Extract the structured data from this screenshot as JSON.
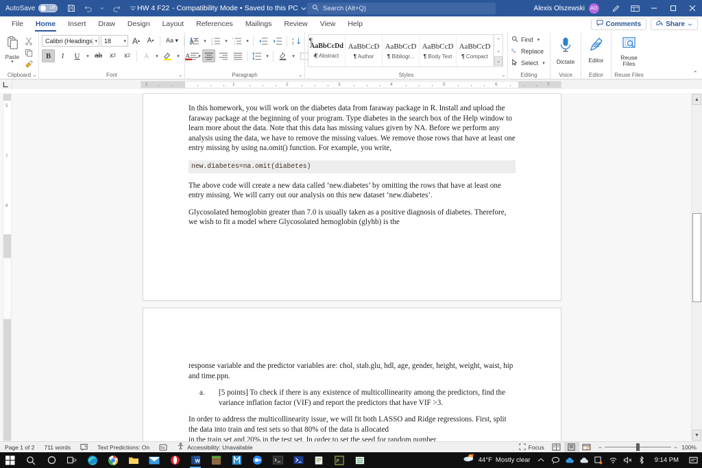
{
  "titlebar": {
    "autosave_label": "AutoSave",
    "autosave_state": "Off",
    "doc_title": "HW 4 F22",
    "doc_status": "-  Compatibility Mode  •  Saved to this PC",
    "search_placeholder": "Search (Alt+Q)",
    "user_name": "Alexis Olszewski",
    "user_initials": "AO",
    "icons": [
      "save-icon",
      "undo-icon",
      "redo-icon",
      "customize-quick-access-icon"
    ],
    "window_buttons": [
      "minimize",
      "restore",
      "close"
    ]
  },
  "ribbon_tabs": [
    {
      "label": "File",
      "active": false
    },
    {
      "label": "Home",
      "active": true
    },
    {
      "label": "Insert",
      "active": false
    },
    {
      "label": "Draw",
      "active": false
    },
    {
      "label": "Design",
      "active": false
    },
    {
      "label": "Layout",
      "active": false
    },
    {
      "label": "References",
      "active": false
    },
    {
      "label": "Mailings",
      "active": false
    },
    {
      "label": "Review",
      "active": false
    },
    {
      "label": "View",
      "active": false
    },
    {
      "label": "Help",
      "active": false
    }
  ],
  "tabs_right": {
    "comments_label": "Comments",
    "share_label": "Share"
  },
  "ribbon": {
    "clipboard": {
      "group_label": "Clipboard",
      "paste_label": "Paste",
      "cut_label": "Cut",
      "copy_label": "Copy",
      "format_painter_label": "Format Painter"
    },
    "font": {
      "group_label": "Font",
      "font_name": "Calibri (Headings)",
      "font_size": "18",
      "buttons": [
        "grow-font",
        "shrink-font",
        "change-case",
        "clear-formatting",
        "bold",
        "italic",
        "underline",
        "strikethrough",
        "subscript",
        "superscript",
        "text-effects",
        "highlight",
        "font-color"
      ],
      "bold_active": true
    },
    "paragraph": {
      "group_label": "Paragraph",
      "align_active": "justify"
    },
    "styles": {
      "group_label": "Styles",
      "items": [
        {
          "sample": "AaBbCcDd",
          "name": "Abstract",
          "bold": true
        },
        {
          "sample": "AaBbCcD",
          "name": "Author",
          "bold": false
        },
        {
          "sample": "AaBbCcD",
          "name": "Bibliogr...",
          "bold": false
        },
        {
          "sample": "AaBbCcD",
          "name": "Body Text",
          "bold": false
        },
        {
          "sample": "AaBbCcD",
          "name": "Compact",
          "bold": false
        }
      ],
      "mark": "¶"
    },
    "editing": {
      "group_label": "Editing",
      "find_label": "Find",
      "replace_label": "Replace",
      "select_label": "Select"
    },
    "voice": {
      "group_label": "Voice",
      "dictate_label": "Dictate"
    },
    "editor": {
      "group_label": "Editor",
      "editor_label": "Editor"
    },
    "reuse": {
      "group_label": "Reuse Files",
      "reuse_label": "Reuse\nFiles",
      "reuse_line1": "Reuse",
      "reuse_line2": "Files"
    }
  },
  "ruler": {
    "h_numbers": [
      "1",
      "1",
      "2",
      "3",
      "4",
      "5",
      "6",
      "7"
    ],
    "v_numbers": [
      "5",
      "7",
      "8"
    ]
  },
  "document": {
    "page1": {
      "paragraph1": "In this homework, you will work on the diabetes data from faraway package in R. Install and upload the faraway package at the beginning of your program. Type diabetes in the search box of the Help window to learn more about the data. Note that this data has missing values given by NA. Before we perform any analysis using the data, we have to remove the missing values. We remove those rows that have at least one entry missing by using na.omit() function. For example, you write,",
      "code1": "new.diabetes=na.omit(diabetes)",
      "paragraph2": "The above code will create a new data called ‘new.diabetes’ by omitting the rows that have at least one entry missing. We will carry out our analysis on this new dataset ‘new.diabetes’.",
      "paragraph3": "Glycosolated hemoglobin greater than 7.0 is usually taken as a positive diagnosis of diabetes. Therefore, we wish to fit a model where Glycosolated hemoglobin (glyhb) is the"
    },
    "page2": {
      "paragraph1": "response variable and the predictor variables are: chol, stab.glu, hdl, age, gender, height, weight, waist, hip and time.ppn.",
      "list_marker_a": "a.",
      "list_item_a": "[5 points] To check if there is any existence of multicollinearity among the predictors, find the variance inflation factor (VIF) and report the predictors that have VIF >3.",
      "paragraph2": "In order to address the multicollinearity issue, we will fit both LASSO and Ridge regressions. First, split the data into train and test sets so that 80% of the data is allocated",
      "paragraph3_clipped": "in the train set and 20% in the test set. In order to set the seed for random number"
    }
  },
  "statusbar": {
    "page_label": "Page 1 of 2",
    "word_count": "711 words",
    "proofing_icon": "proofing-errors-icon",
    "text_predictions": "Text Predictions: On",
    "accessibility": "Accessibility: Unavailable",
    "focus_label": "Focus",
    "zoom_level": "100%",
    "view_read": "read-mode-icon",
    "view_print": "print-layout-icon",
    "view_web": "web-layout-icon"
  },
  "taskbar": {
    "apps": [
      "start-icon",
      "search-icon",
      "cortana-icon",
      "task-view-icon",
      "edge-icon",
      "chrome-icon",
      "file-explorer-icon",
      "mail-icon",
      "opera-icon",
      "word-icon",
      "minecraft-icon",
      "krita-icon",
      "zoom-icon",
      "terminal-icon",
      "powershell-icon",
      "notepad-icon",
      "vscode-icon",
      "excel-icon"
    ],
    "weather_temp": "44°F",
    "weather_desc": "Mostly clear",
    "tray_icons": [
      "show-hidden-icons",
      "discord-icon",
      "onedrive-icon",
      "cloud-icon",
      "screenshot-icon",
      "wifi-icon",
      "volume-muted-icon",
      "bluetooth-icon"
    ],
    "clock": "9:14 PM",
    "notifications": "notification-center-icon"
  },
  "colors": {
    "word_blue": "#2b579a",
    "accent": "#2b579a",
    "avatar": "#b36ae2",
    "taskbar": "#101010"
  }
}
